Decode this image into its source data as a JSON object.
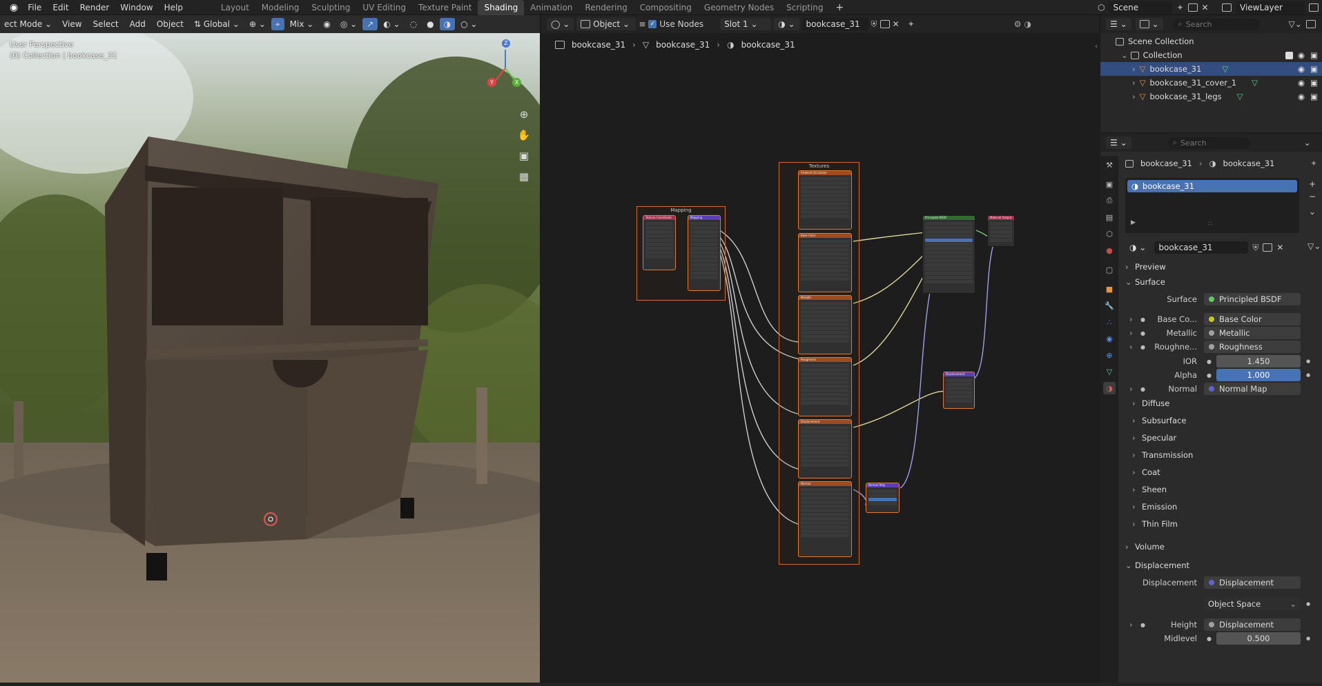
{
  "topbar": {
    "menus": [
      "File",
      "Edit",
      "Render",
      "Window",
      "Help"
    ],
    "workspaces": [
      "Layout",
      "Modeling",
      "Sculpting",
      "UV Editing",
      "Texture Paint",
      "Shading",
      "Animation",
      "Rendering",
      "Compositing",
      "Geometry Nodes",
      "Scripting"
    ],
    "active_workspace": "Shading",
    "add_tab": "+",
    "scene": "Scene",
    "view_layer": "ViewLayer"
  },
  "viewport": {
    "mode": "ect Mode",
    "menus": [
      "View",
      "Select",
      "Add",
      "Object"
    ],
    "orientation": "Global",
    "shading_mix": "Mix",
    "perspective": "User Perspective",
    "collection_info": "(0) Collection | bookcase_31",
    "gizmo_axes": {
      "z": "Z",
      "y": "Y",
      "x": "X"
    }
  },
  "node_editor": {
    "object_mode": "Object",
    "use_nodes_label": "Use Nodes",
    "slot": "Slot 1",
    "material": "bookcase_31",
    "breadcrumb": [
      "bookcase_31",
      "bookcase_31",
      "bookcase_31"
    ],
    "frames": {
      "mapping": "Mapping",
      "textures": "Textures"
    },
    "nodes": {
      "texcoord": "Texture Coordinate",
      "mapping": "Mapping",
      "base_color": "Base Color",
      "metallic": "Metallic",
      "roughness": "Roughness",
      "displacement_tex": "Displacement",
      "normal_tex": "Normal",
      "ambient": "Ambient Occlusion",
      "bsdf": "Principled BSDF",
      "output": "Material Output",
      "disp_node": "Displacement",
      "normal_map": "Normal Map"
    }
  },
  "outliner": {
    "search_placeholder": "Search",
    "scene_collection": "Scene Collection",
    "collection": "Collection",
    "items": [
      "bookcase_31",
      "bookcase_31_cover_1",
      "bookcase_31_legs"
    ]
  },
  "properties": {
    "search_placeholder": "Search",
    "breadcrumb": [
      "bookcase_31",
      "bookcase_31"
    ],
    "material_slot": "bookcase_31",
    "material_name": "bookcase_31",
    "sections": {
      "preview": "Preview",
      "surface": "Surface",
      "volume": "Volume",
      "displacement": "Displacement"
    },
    "surface_rows": [
      {
        "label": "Surface",
        "value": "Principled BSDF",
        "color": "#63c763"
      },
      {
        "label": "Base Co...",
        "value": "Base Color",
        "color": "#c7c729"
      },
      {
        "label": "Metallic",
        "value": "Metallic",
        "color": "#a1a1a1"
      },
      {
        "label": "Roughne...",
        "value": "Roughness",
        "color": "#a1a1a1"
      }
    ],
    "ior": {
      "label": "IOR",
      "value": "1.450"
    },
    "alpha": {
      "label": "Alpha",
      "value": "1.000"
    },
    "normal": {
      "label": "Normal",
      "value": "Normal Map",
      "color": "#6363c7"
    },
    "subsections": [
      "Diffuse",
      "Subsurface",
      "Specular",
      "Transmission",
      "Coat",
      "Sheen",
      "Emission",
      "Thin Film"
    ],
    "displacement_rows": {
      "displacement": {
        "label": "Displacement",
        "value": "Displacement",
        "color": "#6363c7"
      },
      "space": "Object Space",
      "height": {
        "label": "Height",
        "value": "Displacement",
        "color": "#a1a1a1"
      },
      "midlevel": {
        "label": "Midlevel",
        "value": "0.500"
      }
    }
  }
}
